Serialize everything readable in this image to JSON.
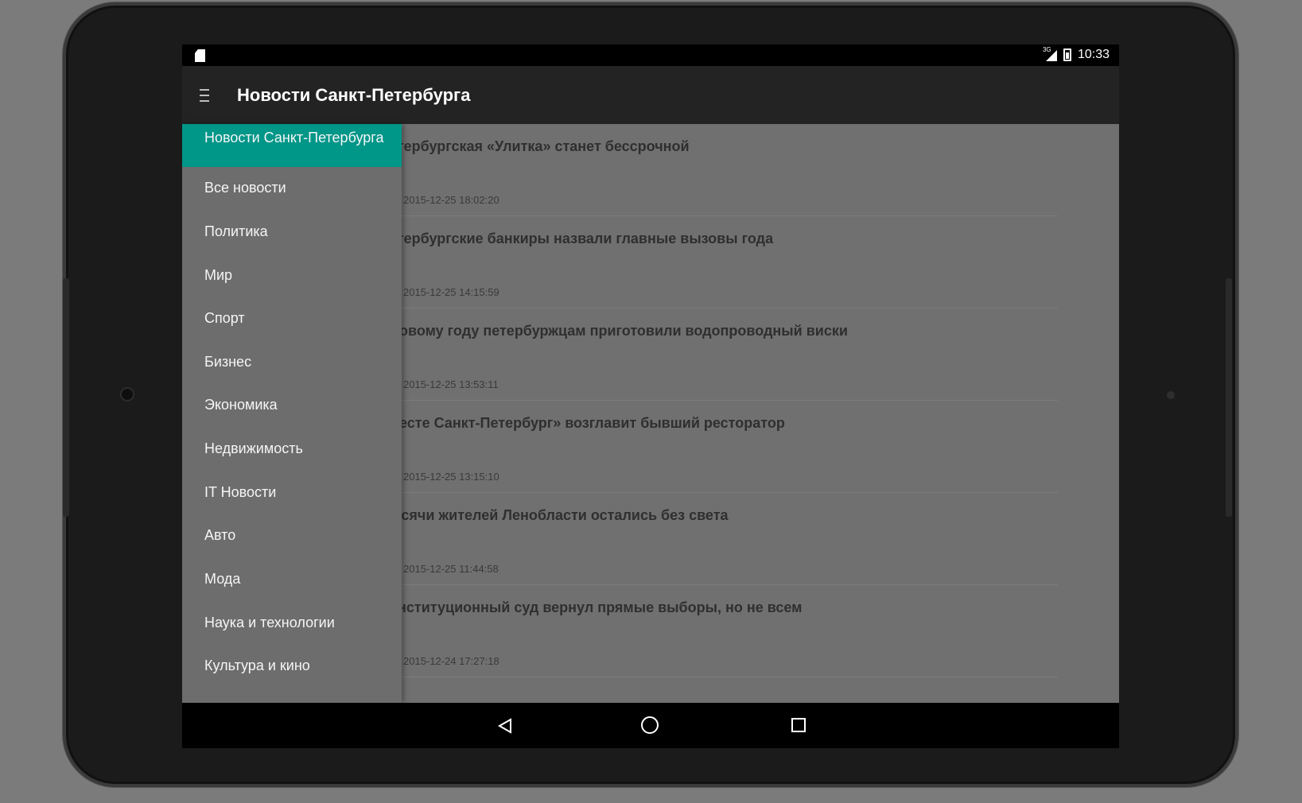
{
  "status_bar": {
    "network_label": "3G",
    "time": "10:33",
    "icons": [
      "sd-card-icon",
      "signal-icon",
      "battery-icon"
    ]
  },
  "app_bar": {
    "title": "Новости Санкт-Петербурга",
    "menu_icon": "hamburger-menu-icon"
  },
  "drawer": {
    "items": [
      {
        "label": "Новости Санкт-Петербурга",
        "active": true
      },
      {
        "label": "Все новости"
      },
      {
        "label": "Политика"
      },
      {
        "label": "Мир"
      },
      {
        "label": "Спорт"
      },
      {
        "label": "Бизнес"
      },
      {
        "label": "Экономика"
      },
      {
        "label": "Недвижимость"
      },
      {
        "label": "IT Новости"
      },
      {
        "label": "Авто"
      },
      {
        "label": "Мода"
      },
      {
        "label": "Наука и технологии"
      },
      {
        "label": "Культура и кино"
      }
    ]
  },
  "news": {
    "items": [
      {
        "title": "етербургская «Улитка» станет бессрочной",
        "date": "2015-12-25 18:02:20"
      },
      {
        "title": "етербургские банкиры назвали главные вызовы года",
        "date": "2015-12-25 14:15:59"
      },
      {
        "title": "Новому году петербуржцам приготовили водопроводный виски",
        "date": "2015-12-25 13:53:11"
      },
      {
        "title": "Несте Санкт-Петербург» возглавит бывший ресторатор",
        "date": "2015-12-25 13:15:10"
      },
      {
        "title": "ысячи жителей Ленобласти остались без света",
        "date": "2015-12-25 11:44:58"
      },
      {
        "title": "онституционный суд вернул прямые выборы, но не всем",
        "date": "2015-12-24 17:27:18"
      }
    ]
  },
  "nav_bar": {
    "icons": [
      "back-icon",
      "home-icon",
      "recent-apps-icon"
    ]
  },
  "colors": {
    "accent": "#009688",
    "appbar": "#232323",
    "statusbar": "#000000"
  }
}
